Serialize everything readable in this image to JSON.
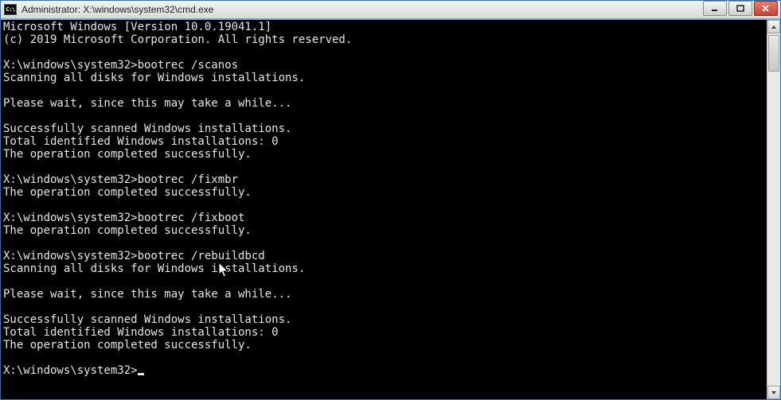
{
  "titlebar": {
    "icon_text": "C:\\",
    "title": "Administrator: X:\\windows\\system32\\cmd.exe"
  },
  "console": {
    "banner1": "Microsoft Windows [Version 10.0.19041.1]",
    "banner2": "(c) 2019 Microsoft Corporation. All rights reserved.",
    "prompt": "X:\\windows\\system32>",
    "cmd1": "bootrec /scanos",
    "scanmsg": "Scanning all disks for Windows installations.",
    "wait": "Please wait, since this may take a while...",
    "done1": "Successfully scanned Windows installations.",
    "done2": "Total identified Windows installations: 0",
    "done3": "The operation completed successfully.",
    "cmd2": "bootrec /fixmbr",
    "cmd3": "bootrec /fixboot",
    "cmd4": "bootrec /rebuildbcd"
  }
}
